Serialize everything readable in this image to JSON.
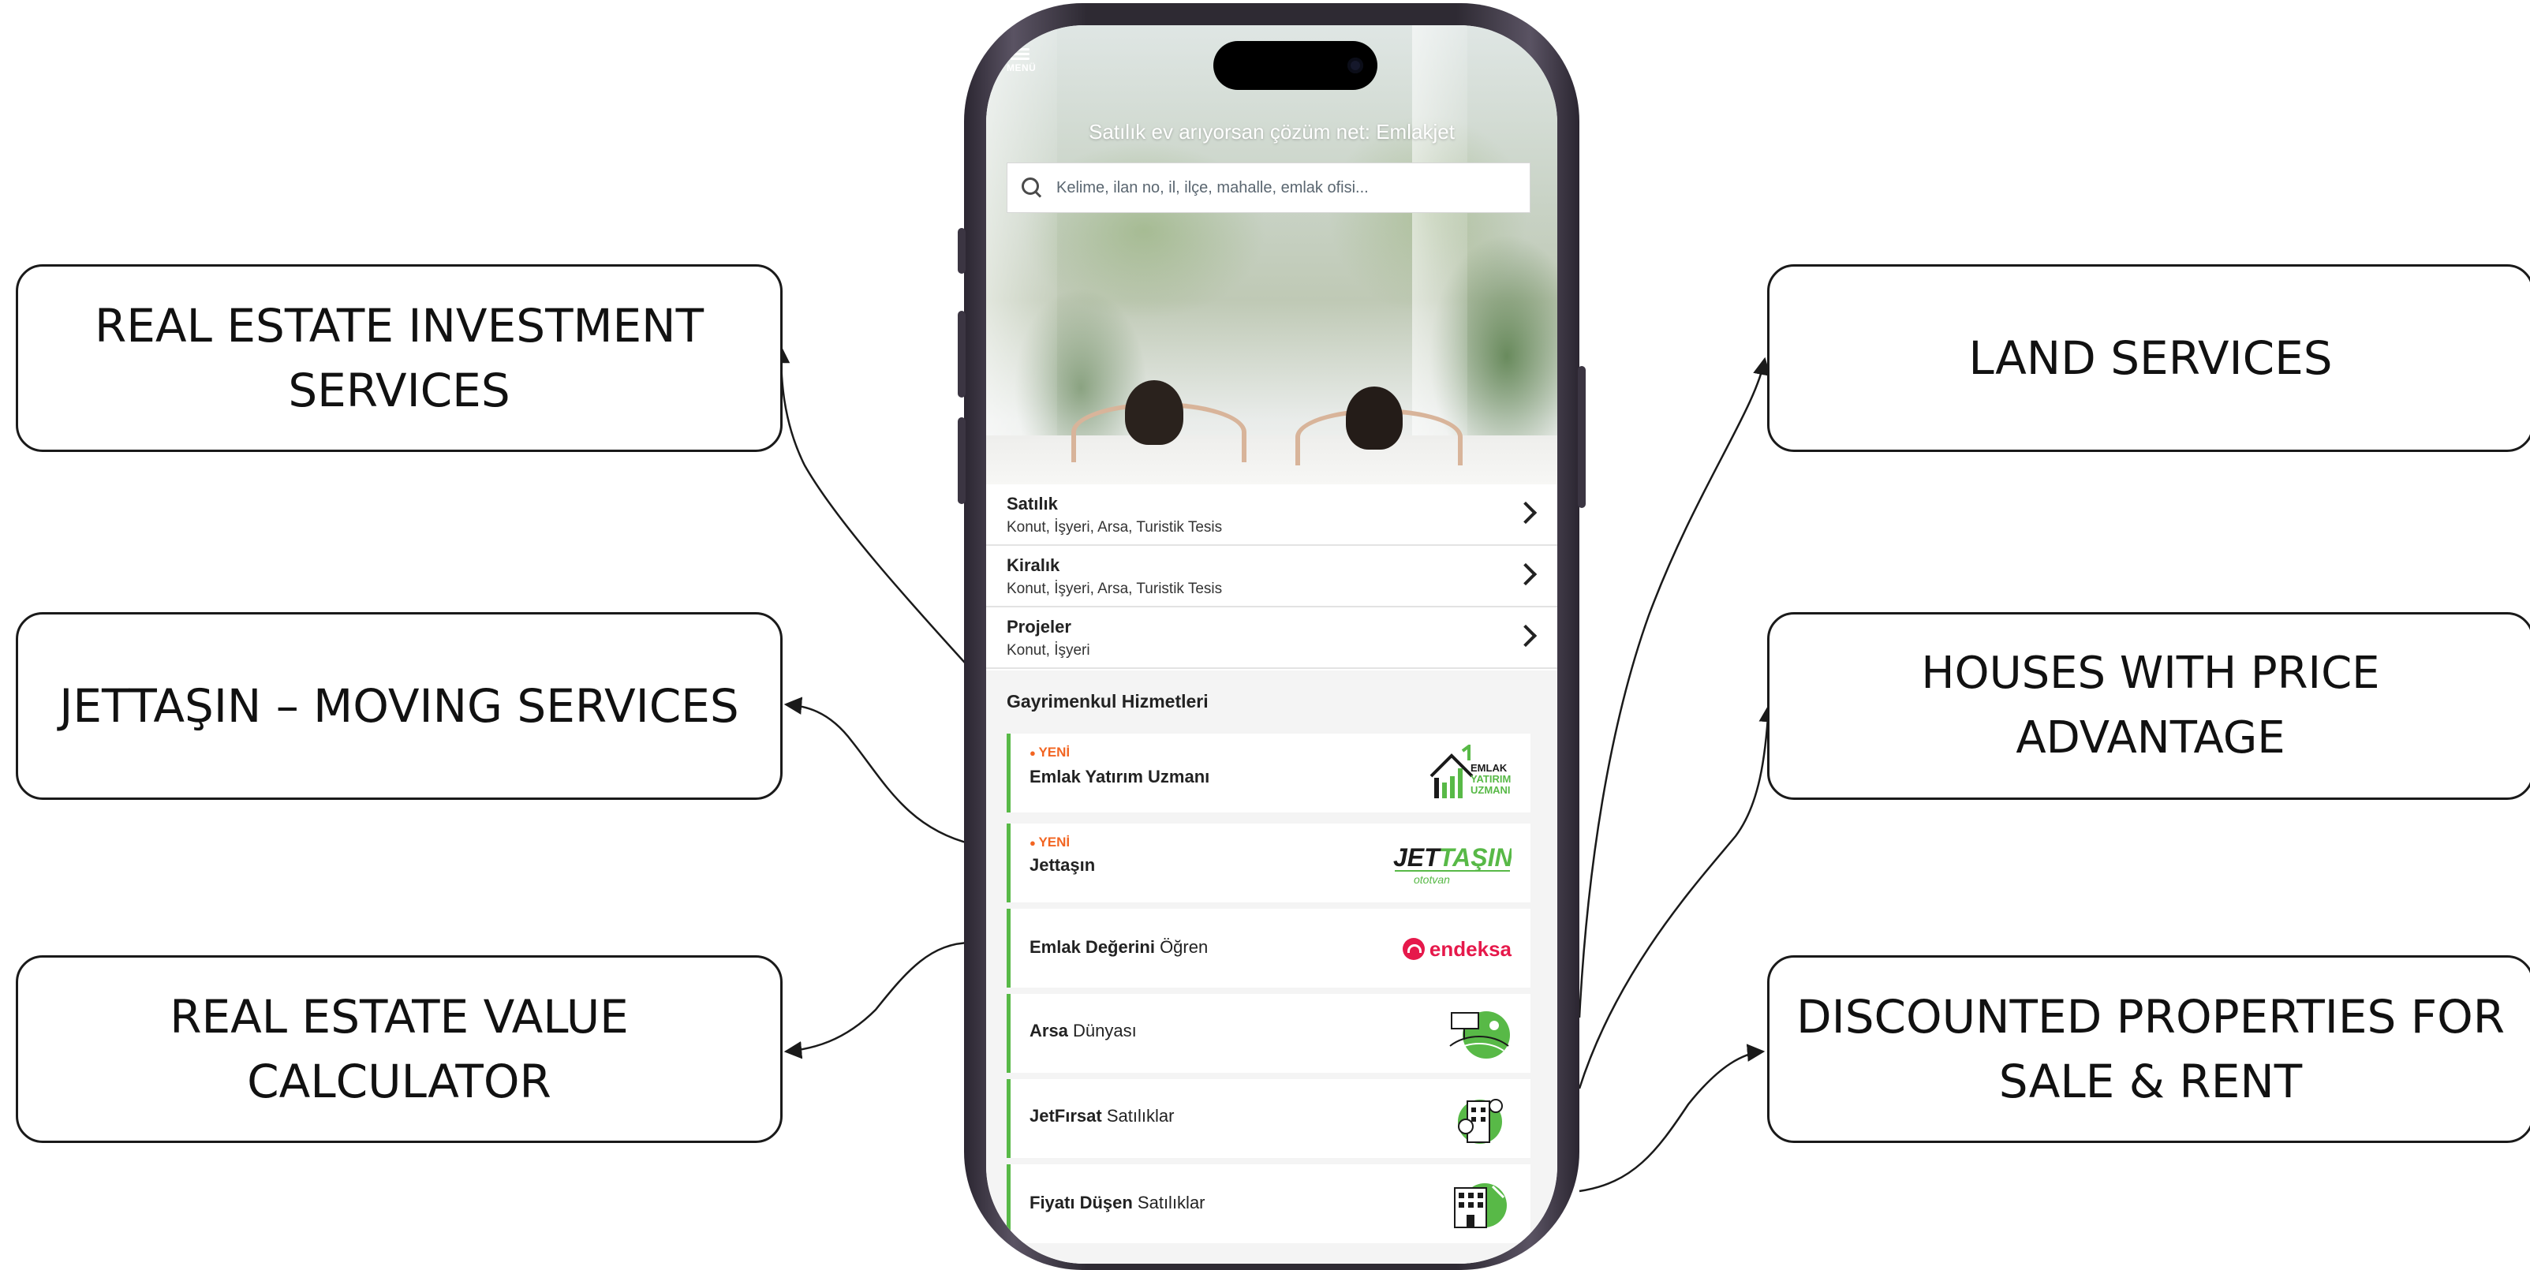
{
  "callouts": {
    "investment": [
      "REAL ESTATE INVESTMENT",
      "SERVICES"
    ],
    "moving": [
      "JETTAŞIN – MOVING SERVICES"
    ],
    "value_calc": [
      "REAL ESTATE VALUE",
      "CALCULATOR"
    ],
    "land": [
      "LAND SERVICES"
    ],
    "price_advantage": [
      "HOUSES WITH PRICE ADVANTAGE"
    ],
    "discounted": [
      "DISCOUNTED PROPERTIES FOR",
      "SALE & RENT"
    ]
  },
  "app": {
    "menu_label": "MENÜ",
    "tagline": "Satılık ev arıyorsan çözüm net: Emlakjet",
    "search_placeholder": "Kelime, ilan no, il, ilçe, mahalle, emlak ofisi...",
    "categories": [
      {
        "title": "Satılık",
        "subtitle": "Konut, İşyeri, Arsa, Turistik Tesis"
      },
      {
        "title": "Kiralık",
        "subtitle": "Konut, İşyeri, Arsa, Turistik Tesis"
      },
      {
        "title": "Projeler",
        "subtitle": "Konut, İşyeri"
      }
    ],
    "services_title": "Gayrimenkul Hizmetleri",
    "services": [
      {
        "badge": "YENİ",
        "bold": "Emlak Yatırım Uzmanı",
        "rest": "",
        "logo_text": [
          "EMLAK",
          "YATIRIM",
          "UZMANI"
        ]
      },
      {
        "badge": "YENİ",
        "bold": "Jettaşın",
        "rest": "",
        "logo_text": [
          "JET",
          "TAŞIN",
          "ototvan"
        ]
      },
      {
        "badge": "",
        "bold": "Emlak Değerini",
        "rest": " Öğren",
        "logo_text": [
          "endeksa"
        ]
      },
      {
        "badge": "",
        "bold": "Arsa",
        "rest": " Dünyası",
        "logo_text": []
      },
      {
        "badge": "",
        "bold": "JetFırsat",
        "rest": " Satılıklar",
        "logo_text": []
      },
      {
        "badge": "",
        "bold": "Fiyatı Düşen",
        "rest": " Satılıklar",
        "logo_text": []
      }
    ]
  },
  "colors": {
    "brand_green": "#58b947",
    "badge_orange": "#f26522",
    "endeksa_red": "#e6194b"
  }
}
